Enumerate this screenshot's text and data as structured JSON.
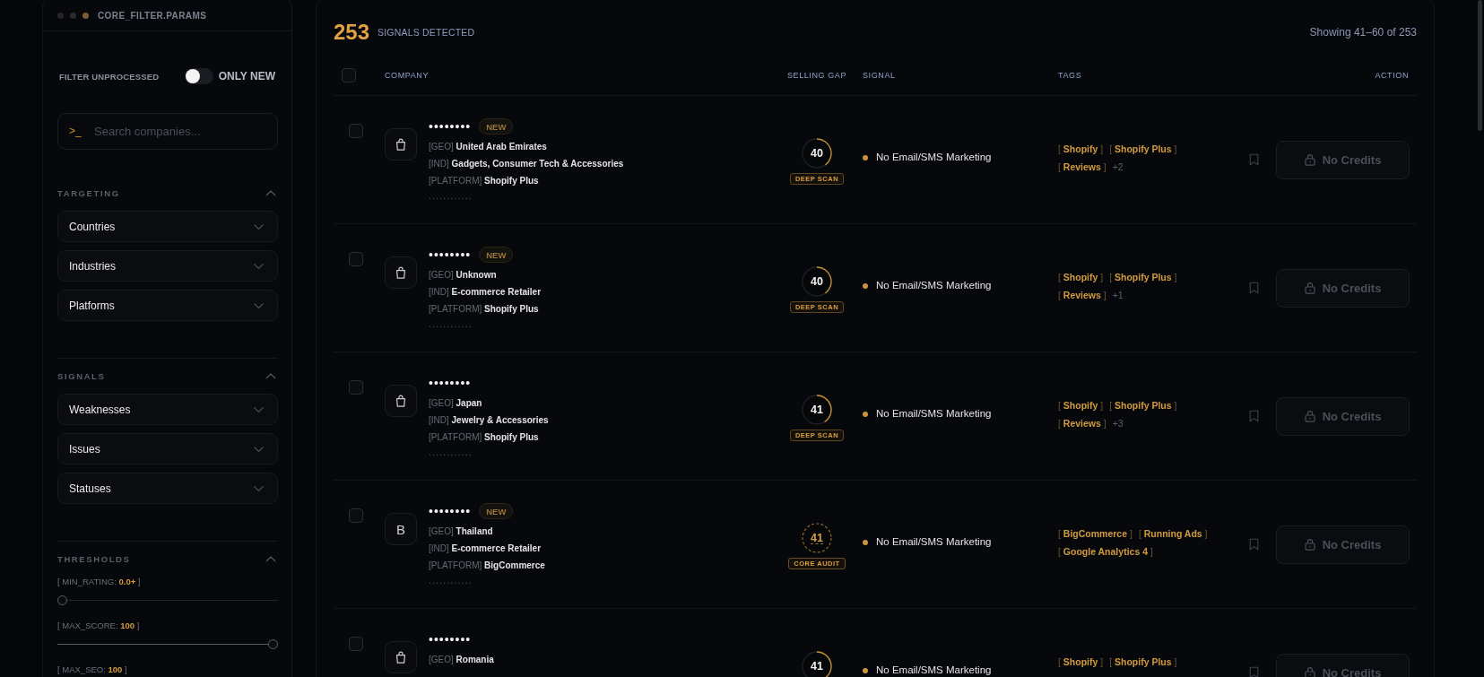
{
  "sidebar": {
    "window_dots": [
      {
        "color": "#262629"
      },
      {
        "color": "#2b2b2e"
      },
      {
        "color": "#7d5d33"
      }
    ],
    "title": "CORE_FILTER.PARAMS",
    "filter": {
      "label": "FILTER UNPROCESSED",
      "toggle_label": "ONLY NEW",
      "on": false
    },
    "search": {
      "prompt": ">_",
      "placeholder": "Search companies..."
    },
    "sections": [
      {
        "kind": "dropdowns",
        "title": "TARGETING",
        "expanded": true,
        "items": [
          "Countries",
          "Industries",
          "Platforms"
        ]
      },
      {
        "kind": "dropdowns",
        "title": "SIGNALS",
        "expanded": true,
        "items": [
          "Weaknesses",
          "Issues",
          "Statuses"
        ]
      },
      {
        "kind": "sliders",
        "title": "THRESHOLDS",
        "expanded": true,
        "items": [
          {
            "label": "[ MIN_RATING: **0.0+** ]",
            "level": 0
          },
          {
            "label": "[ MAX_SCORE: **100** ]",
            "level": 1
          },
          {
            "label": "[ MAX_SEO: **100** ]"
          }
        ]
      }
    ]
  },
  "main": {
    "count": "253",
    "count_label": "SIGNALS DETECTED",
    "range": "Showing 41–60 of 253",
    "table": {
      "select_all": {
        "checked": false
      },
      "columns": [
        "COMPANY",
        "SELLING GAP",
        "SIGNAL",
        "TAGS",
        "ACTION"
      ],
      "rows": [
        {
          "checked": false,
          "logo": {
            "kind": "bag"
          },
          "name": "••••••••",
          "badge": "NEW",
          "details": [
            "[GEO] **United Arab Emirates**",
            "[IND] **Gadgets, Consumer Tech & Accessories**",
            "[PLATFORM] **Shopify Plus**"
          ],
          "masked": "............",
          "gap": {
            "kind": "deep",
            "score": "40",
            "level": 0.4,
            "label": "DEEP SCAN"
          },
          "signal": "No Email/SMS Marketing",
          "tags": [
            "[ **Shopify** ]",
            "[ **Shopify Plus** ]",
            "[ **Reviews** ]"
          ],
          "more": "+2",
          "bookmarked": false,
          "action": {
            "label": "No Credits",
            "disabled": true
          }
        },
        {
          "checked": false,
          "logo": {
            "kind": "bag"
          },
          "name": "••••••••",
          "badge": "NEW",
          "details": [
            "[GEO] **Unknown**",
            "[IND] **E-commerce Retailer**",
            "[PLATFORM] **Shopify Plus**"
          ],
          "masked": "............",
          "gap": {
            "kind": "deep",
            "score": "40",
            "level": 0.4,
            "label": "DEEP SCAN"
          },
          "signal": "No Email/SMS Marketing",
          "tags": [
            "[ **Shopify** ]",
            "[ **Shopify Plus** ]",
            "[ **Reviews** ]"
          ],
          "more": "+1",
          "bookmarked": false,
          "action": {
            "label": "No Credits",
            "disabled": true
          }
        },
        {
          "checked": false,
          "logo": {
            "kind": "bag"
          },
          "name": "••••••••",
          "details": [
            "[GEO] **Japan**",
            "[IND] **Jewelry & Accessories**",
            "[PLATFORM] **Shopify Plus**"
          ],
          "masked": "............",
          "gap": {
            "kind": "deep",
            "score": "41",
            "level": 0.41,
            "label": "DEEP SCAN"
          },
          "signal": "No Email/SMS Marketing",
          "tags": [
            "[ **Shopify** ]",
            "[ **Shopify Plus** ]",
            "[ **Reviews** ]"
          ],
          "more": "+3",
          "bookmarked": false,
          "action": {
            "label": "No Credits",
            "disabled": true
          }
        },
        {
          "checked": false,
          "logo": {
            "kind": "letter",
            "text": "B"
          },
          "name": "••••••••",
          "badge": "NEW",
          "details": [
            "[GEO] **Thailand**",
            "[IND] **E-commerce Retailer**",
            "[PLATFORM] **BigCommerce**"
          ],
          "masked": "............",
          "gap": {
            "kind": "core",
            "score": "41",
            "label": "CORE AUDIT"
          },
          "signal": "No Email/SMS Marketing",
          "tags": [
            "[ **BigCommerce** ]",
            "[ **Running Ads** ]",
            "[ **Google Analytics 4** ]"
          ],
          "bookmarked": false,
          "action": {
            "label": "No Credits",
            "disabled": true
          }
        },
        {
          "checked": false,
          "logo": {
            "kind": "bag"
          },
          "name": "••••••••",
          "details": [
            "[GEO] **Romania**"
          ],
          "gap": {
            "kind": "deep",
            "score": "41",
            "level": 0.41
          },
          "signal": "No Email/SMS Marketing",
          "tags": [
            "[ **Shopify** ]",
            "[ **Shopify Plus** ]"
          ],
          "bookmarked": false,
          "action": {
            "label": "No Credits",
            "disabled": true
          }
        }
      ]
    }
  }
}
